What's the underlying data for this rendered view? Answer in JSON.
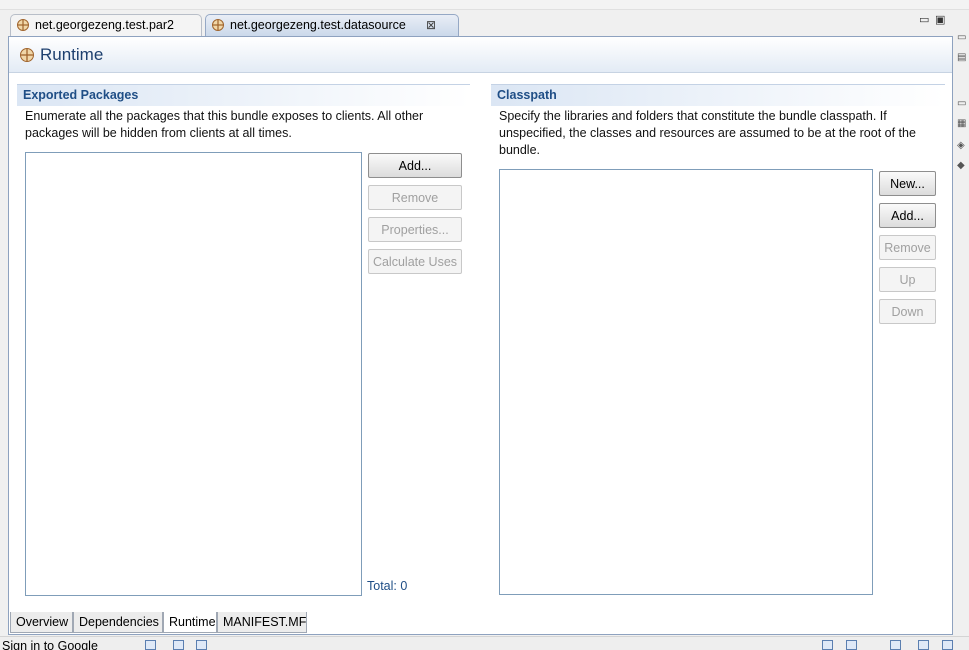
{
  "editor_tabs": [
    {
      "label": "net.georgezeng.test.par2",
      "active": false
    },
    {
      "label": "net.georgezeng.test.datasource",
      "active": true
    }
  ],
  "tab_close_glyph": "⊠",
  "view_controls": {
    "minimize": "▭",
    "maximize": "▣"
  },
  "form": {
    "title": "Runtime",
    "icon": "plugin-icon"
  },
  "exported_packages": {
    "title": "Exported Packages",
    "description": "Enumerate all the packages that this bundle exposes to clients. All other packages will be hidden from clients at all times.",
    "buttons": {
      "add": "Add...",
      "remove": "Remove",
      "properties": "Properties...",
      "calculate_uses": "Calculate Uses"
    },
    "total": "Total: 0"
  },
  "classpath": {
    "title": "Classpath",
    "description": "Specify the libraries and folders that constitute the bundle classpath. If unspecified, the classes and resources are assumed to be at the root of the bundle.",
    "buttons": {
      "new": "New...",
      "add": "Add...",
      "remove": "Remove",
      "up": "Up",
      "down": "Down"
    }
  },
  "page_tabs": [
    {
      "label": "Overview",
      "active": false
    },
    {
      "label": "Dependencies",
      "active": false
    },
    {
      "label": "Runtime",
      "active": true
    },
    {
      "label": "MANIFEST.MF",
      "active": false
    }
  ],
  "status_bar": {
    "text": "Sign in to Google"
  },
  "colors": {
    "section_title": "#1f4e86",
    "form_title": "#1d3f6e",
    "list_border": "#7f9db9"
  }
}
